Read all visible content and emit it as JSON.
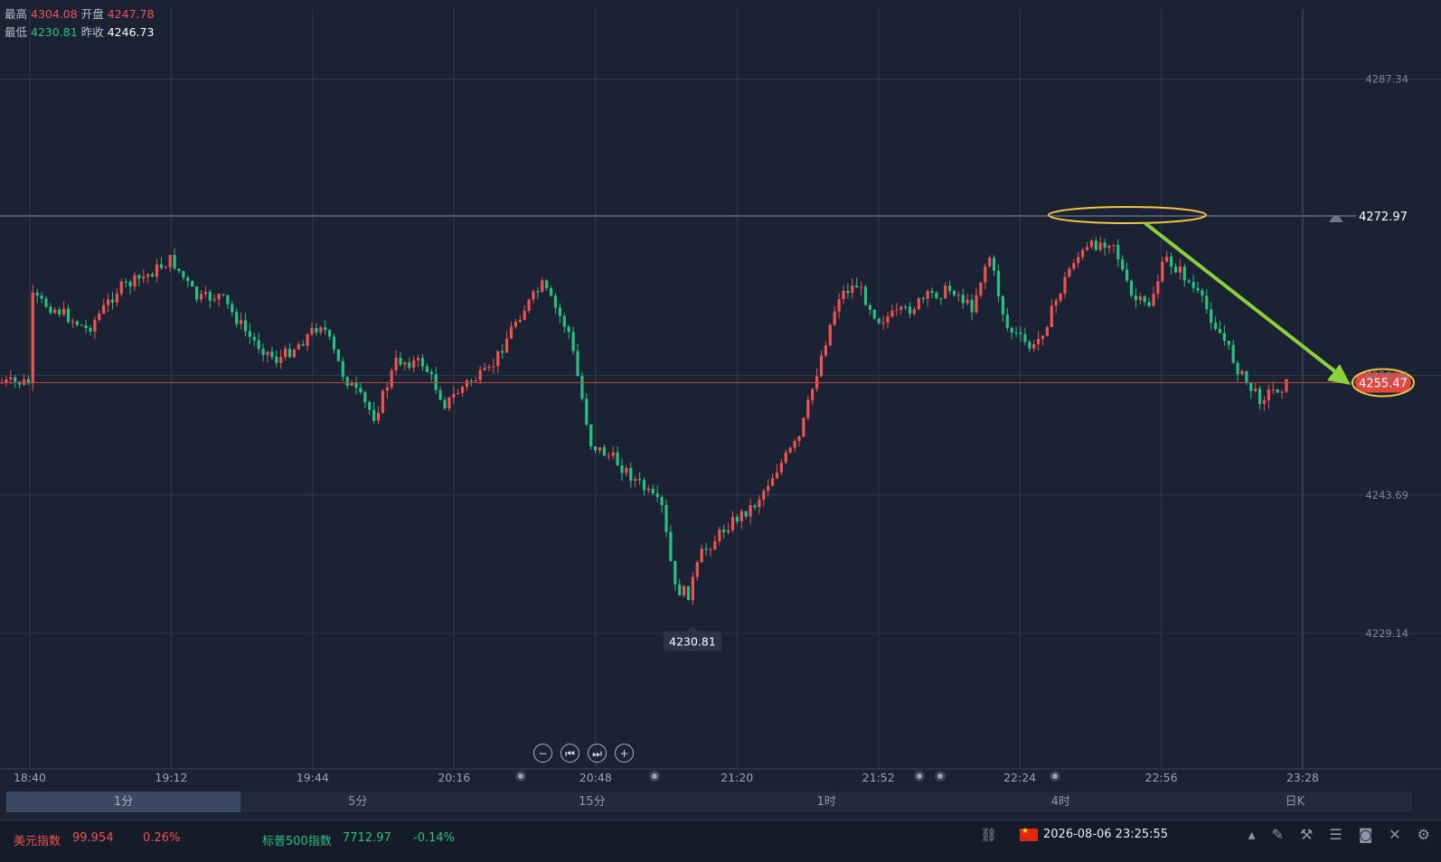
{
  "ohlc": {
    "high_label": "最高",
    "high": "4304.08",
    "open_label": "开盘",
    "open": "4247.78",
    "low_label": "最低",
    "low": "4230.81",
    "prev_label": "昨收",
    "prev_close": "4246.73"
  },
  "chart_data": {
    "type": "candlestick",
    "y_axis_ticks": [
      "4287.34",
      "4256.24",
      "4243.69",
      "4229.14"
    ],
    "x_axis_ticks": [
      "18:40",
      "19:12",
      "19:44",
      "20:16",
      "20:48",
      "21:20",
      "21:52",
      "22:24",
      "22:56",
      "23:28"
    ],
    "horizontal_line": "4272.97",
    "current_price": "4255.47",
    "low_marker": "4230.81",
    "close_path": [
      {
        "t": "18:40",
        "c": 4264.5
      },
      {
        "t": "18:47",
        "c": 4262.9
      },
      {
        "t": "18:53",
        "c": 4261.0
      },
      {
        "t": "19:00",
        "c": 4265.3
      },
      {
        "t": "19:06",
        "c": 4266.6
      },
      {
        "t": "19:12",
        "c": 4268.4
      },
      {
        "t": "19:18",
        "c": 4264.2
      },
      {
        "t": "19:23",
        "c": 4264.6
      },
      {
        "t": "19:30",
        "c": 4260.1
      },
      {
        "t": "19:36",
        "c": 4257.8
      },
      {
        "t": "19:41",
        "c": 4259.6
      },
      {
        "t": "19:46",
        "c": 4261.8
      },
      {
        "t": "19:51",
        "c": 4256.2
      },
      {
        "t": "19:58",
        "c": 4251.9
      },
      {
        "t": "20:03",
        "c": 4257.8
      },
      {
        "t": "20:09",
        "c": 4257.5
      },
      {
        "t": "20:14",
        "c": 4253.2
      },
      {
        "t": "20:19",
        "c": 4255.5
      },
      {
        "t": "20:24",
        "c": 4256.6
      },
      {
        "t": "20:30",
        "c": 4262.1
      },
      {
        "t": "20:36",
        "c": 4265.7
      },
      {
        "t": "20:42",
        "c": 4260.7
      },
      {
        "t": "20:47",
        "c": 4249.0
      },
      {
        "t": "20:52",
        "c": 4247.5
      },
      {
        "t": "20:58",
        "c": 4244.8
      },
      {
        "t": "21:03",
        "c": 4242.3
      },
      {
        "t": "21:06",
        "c": 4233.8
      },
      {
        "t": "21:09",
        "c": 4233.3
      },
      {
        "t": "21:12",
        "c": 4237.5
      },
      {
        "t": "21:18",
        "c": 4240.6
      },
      {
        "t": "21:24",
        "c": 4242.7
      },
      {
        "t": "21:29",
        "c": 4246.4
      },
      {
        "t": "21:34",
        "c": 4249.5
      },
      {
        "t": "21:39",
        "c": 4258.2
      },
      {
        "t": "21:43",
        "c": 4264.6
      },
      {
        "t": "21:47",
        "c": 4265.8
      },
      {
        "t": "21:52",
        "c": 4262.1
      },
      {
        "t": "21:58",
        "c": 4262.9
      },
      {
        "t": "22:04",
        "c": 4264.7
      },
      {
        "t": "22:09",
        "c": 4265.3
      },
      {
        "t": "22:13",
        "c": 4263.2
      },
      {
        "t": "22:17",
        "c": 4269.0
      },
      {
        "t": "22:21",
        "c": 4261.3
      },
      {
        "t": "22:27",
        "c": 4258.9
      },
      {
        "t": "22:31",
        "c": 4262.7
      },
      {
        "t": "22:36",
        "c": 4268.3
      },
      {
        "t": "22:41",
        "c": 4270.0
      },
      {
        "t": "22:45",
        "c": 4270.5
      },
      {
        "t": "22:49",
        "c": 4264.5
      },
      {
        "t": "22:53",
        "c": 4263.4
      },
      {
        "t": "22:57",
        "c": 4268.5
      },
      {
        "t": "23:01",
        "c": 4266.8
      },
      {
        "t": "23:05",
        "c": 4264.2
      },
      {
        "t": "23:10",
        "c": 4260.1
      },
      {
        "t": "23:14",
        "c": 4256.3
      },
      {
        "t": "23:18",
        "c": 4253.8
      },
      {
        "t": "23:21",
        "c": 4254.6
      },
      {
        "t": "23:25",
        "c": 4255.47
      }
    ]
  },
  "controls": {
    "zoom_out": "−",
    "first": "⏮",
    "last": "⏭",
    "zoom_in": "+"
  },
  "tabs": [
    "1分",
    "5分",
    "15分",
    "1时",
    "4时",
    "日K"
  ],
  "status": {
    "t1_name": "美元指数",
    "t1_value": "99.954",
    "t1_change": "0.26%",
    "t2_name": "标普500指数",
    "t2_value": "7712.97",
    "t2_change": "-0.14%",
    "datetime": "2026-08-06 23:25:55"
  },
  "colors": {
    "up": "#ef5350",
    "down": "#26c281",
    "background": "#1b2233",
    "annotation": "#f5c542",
    "arrow": "#8bd13a"
  }
}
